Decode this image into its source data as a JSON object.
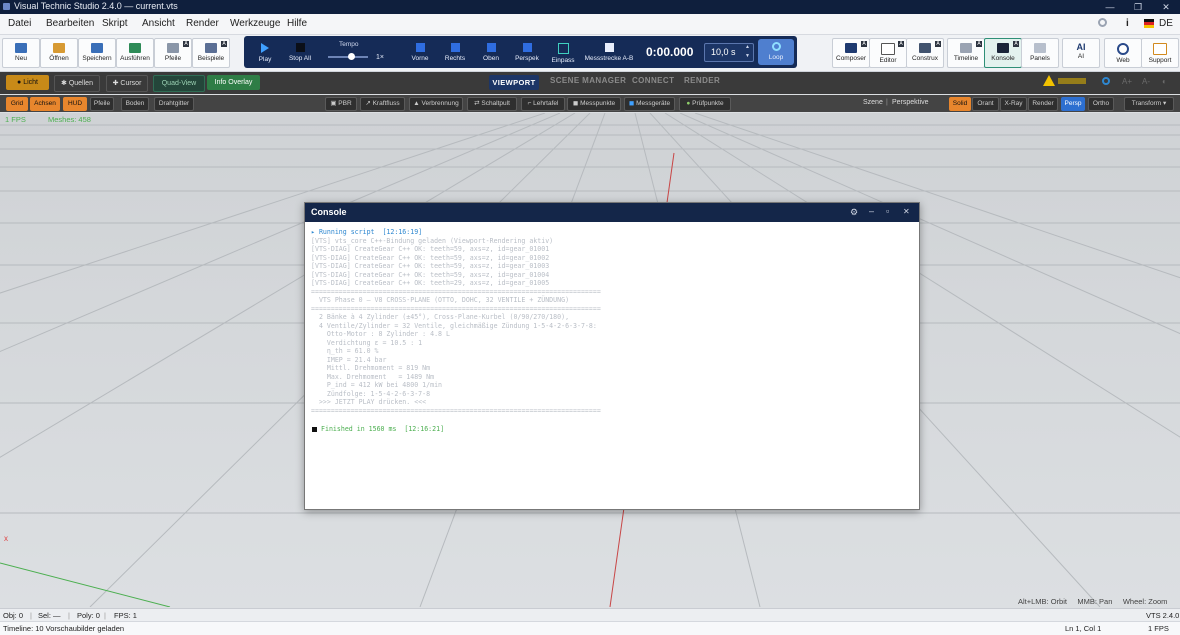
{
  "window": {
    "title": "Visual Technic Studio 2.4.0 — current.vts"
  },
  "menu": [
    "Datei",
    "Bearbeiten",
    "Skript",
    "Ansicht",
    "Render",
    "Werkzeuge",
    "Hilfe"
  ],
  "menu_right": {
    "info": "i",
    "lang": "DE"
  },
  "toolbar_left": [
    {
      "label": "Neu"
    },
    {
      "label": "Öffnen"
    },
    {
      "label": "Speichern"
    },
    {
      "label": "Ausführen"
    },
    {
      "label": "Pfeile"
    },
    {
      "label": "Beispiele"
    }
  ],
  "transport": {
    "play": "Play",
    "stop": "Stop All",
    "tempo_label": "Tempo",
    "tempo_value": "1×",
    "views": [
      "Vorne",
      "Rechts",
      "Oben",
      "Perspek",
      "Einpass",
      "Messstrecke A-B"
    ],
    "time": "0:00.000",
    "duration": "10,0 s",
    "loop": "Loop"
  },
  "toolbar_right": [
    {
      "label": "Composer"
    },
    {
      "label": "Editor"
    },
    {
      "label": "Construx"
    },
    {
      "label": "Timeline"
    },
    {
      "label": "Konsole"
    },
    {
      "label": "Panels"
    },
    {
      "label": "AI",
      "icon_text": "AI"
    },
    {
      "label": "Web"
    },
    {
      "label": "Support"
    }
  ],
  "bar2": {
    "licht": "Licht",
    "quellen": "Quellen",
    "cursor": "Cursor",
    "quadview": "Quad-View",
    "info_overlay": "Info Overlay",
    "tabs": [
      "VIEWPORT",
      "SCENE MANAGER",
      "CONNECT",
      "RENDER"
    ]
  },
  "bar3": {
    "left": [
      "Grid",
      "Achsen",
      "HUD",
      "Pfeile",
      "Boden",
      "Drahtgitter"
    ],
    "mid": [
      "PBR",
      "Kraftfluss",
      "Verbrennung",
      "Schaltpult",
      "Lehrtafel",
      "Messpunkte",
      "Messgeräte",
      "Prüfpunkte"
    ],
    "scene": "Szene",
    "perspektive": "Perspektive",
    "right": [
      "Solid",
      "Orant",
      "X-Ray",
      "Render",
      "Persp",
      "Ortho"
    ],
    "transform": "Transform ▾"
  },
  "viewport_overlay": {
    "fps": "1 FPS",
    "meshes": "Meshes: 458",
    "hint": "Alt+LMB: Orbit     MMB: Pan     Wheel: Zoom"
  },
  "console": {
    "title": "Console",
    "lines": [
      "▸ Running script  [12:16:19]",
      "[VTS] vts_core C++-Bindung geladen (Viewport-Rendering aktiv)",
      "[VTS-DIAG] CreateGear C++ OK: teeth=59, axs=z, id=gear_01001",
      "[VTS-DIAG] CreateGear C++ OK: teeth=59, axs=z, id=gear_01002",
      "[VTS-DIAG] CreateGear C++ OK: teeth=59, axs=z, id=gear_01003",
      "[VTS-DIAG] CreateGear C++ OK: teeth=59, axs=z, id=gear_01004",
      "[VTS-DIAG] CreateGear C++ OK: teeth=29, axs=z, id=gear_01005",
      "=========================================================================",
      "  VTS Phase 0 — V8 CROSS-PLANE (OTTO, DOHC, 32 VENTILE + ZÜNDUNG)",
      "=========================================================================",
      "  2 Bänke à 4 Zylinder (±45°), Cross-Plane-Kurbel (0/90/270/180),",
      "  4 Ventile/Zylinder = 32 Ventile, gleichmäßige Zündung 1-5-4-2-6-3-7-8:",
      "    Otto-Motor : 8 Zylinder : 4.8 L",
      "    Verdichtung ε = 10.5 : 1",
      "    η_th = 61.0 %",
      "    IMEP = 21.4 bar",
      "    Mittl. Drehmoment = 819 Nm",
      "    Max. Drehmoment   = 1489 Nm",
      "    P_ind = 412 kW bei 4800 1/min",
      "    Zündfolge: 1-5-4-2-6-3-7-8",
      "  >>> JETZT PLAY drücken. <<<",
      "========================================================================="
    ],
    "finished": "Finished in 1560 ms  [12:16:21]"
  },
  "status": {
    "obj": "Obj: 0",
    "sel": "Sel: —",
    "poly": "Poly: 0",
    "fps": "FPS: 1",
    "version": "VTS 2.4.0",
    "timeline": "Timeline: 10 Vorschaubilder geladen",
    "cursor": "Ln 1, Col 1",
    "fps2": "1 FPS"
  },
  "colors": {
    "accent": "#142649",
    "active_orange": "#e8862d",
    "green": "#2e7d46"
  }
}
